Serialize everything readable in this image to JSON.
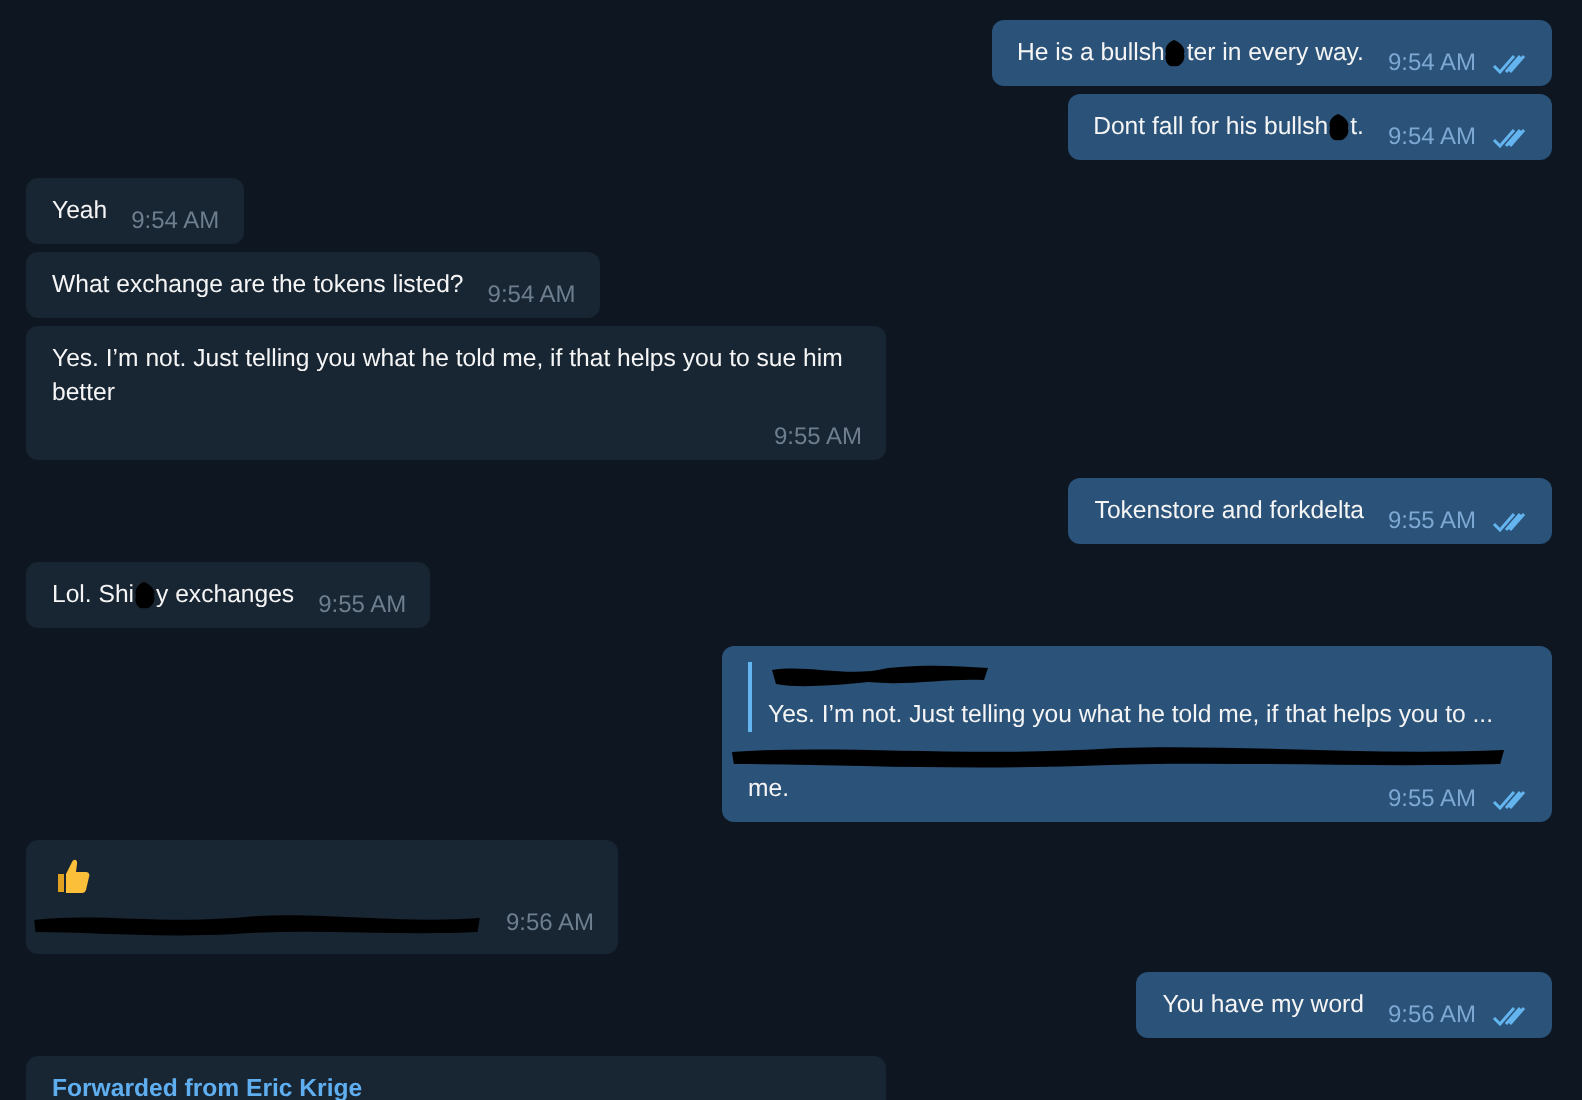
{
  "messages": [
    {
      "outgoing": true,
      "parts": [
        {
          "kind": "text",
          "text": "He is a bullsh"
        },
        {
          "kind": "blot"
        },
        {
          "kind": "text",
          "text": "ter in every way."
        }
      ],
      "time": "9:54 AM",
      "read": true
    },
    {
      "outgoing": true,
      "parts": [
        {
          "kind": "text",
          "text": "Dont fall for his bullsh"
        },
        {
          "kind": "blot"
        },
        {
          "kind": "text",
          "text": "t."
        }
      ],
      "time": "9:54 AM",
      "read": true
    },
    {
      "outgoing": false,
      "parts": [
        {
          "kind": "text",
          "text": "Yeah"
        }
      ],
      "time": "9:54 AM"
    },
    {
      "outgoing": false,
      "parts": [
        {
          "kind": "text",
          "text": "What exchange are the tokens listed?"
        }
      ],
      "time": "9:54 AM"
    },
    {
      "outgoing": false,
      "parts": [
        {
          "kind": "text",
          "text": "Yes. I’m not. Just telling you what he told me, if that helps you to sue him better"
        }
      ],
      "time": "9:55 AM"
    },
    {
      "outgoing": true,
      "parts": [
        {
          "kind": "text",
          "text": "Tokenstore and forkdelta"
        }
      ],
      "time": "9:55 AM",
      "read": true
    },
    {
      "outgoing": false,
      "parts": [
        {
          "kind": "text",
          "text": "Lol. Shi"
        },
        {
          "kind": "blot"
        },
        {
          "kind": "text",
          "text": "y exchanges"
        }
      ],
      "time": "9:55 AM"
    },
    {
      "outgoing": true,
      "reply": {
        "author_redacted": true,
        "text": "Yes. I’m not. Just telling you what he told me, if that helps you to ..."
      },
      "parts": [
        {
          "kind": "line"
        },
        {
          "kind": "text",
          "text": "me."
        }
      ],
      "time": "9:55 AM",
      "read": true
    },
    {
      "outgoing": false,
      "parts": [
        {
          "kind": "thumbs_up"
        },
        {
          "kind": "line"
        }
      ],
      "time": "9:56 AM"
    },
    {
      "outgoing": true,
      "parts": [
        {
          "kind": "text",
          "text": "You have my word"
        }
      ],
      "time": "9:56 AM",
      "read": true
    },
    {
      "outgoing": false,
      "forwarded_from": "Forwarded from Eric Krige"
    }
  ]
}
